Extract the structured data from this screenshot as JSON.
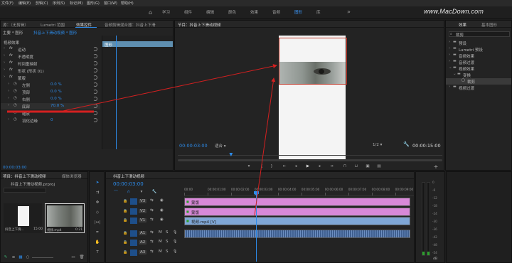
{
  "menubar": {
    "items": [
      "文件(F)",
      "编辑(E)",
      "剪辑(C)",
      "序列(S)",
      "标记(M)",
      "图形(G)",
      "窗口(W)",
      "帮助(H)"
    ]
  },
  "workspaces": {
    "items": [
      "学习",
      "组件",
      "编辑",
      "颜色",
      "效果",
      "音频",
      "图形",
      "库"
    ],
    "active_index": 6,
    "more": "»"
  },
  "watermark": {
    "text": "www.MacDown.com"
  },
  "source_panel": {
    "tabs": [
      "源：（无剪辑）",
      "Lumetri 范围",
      "效果控件",
      "音频剪辑混合器：抖音上下滑"
    ],
    "active_index": 2,
    "header_left": "主要 * 图形",
    "header_right": "抖音上下滑动视频 * 图形",
    "ruler_start": "00:00",
    "clip_bar": "图形",
    "section": "视频效果",
    "rows": [
      {
        "label": "运动",
        "indent": 0,
        "fx": true
      },
      {
        "label": "不透明度",
        "indent": 0,
        "fx": true
      },
      {
        "label": "时间重映射",
        "indent": 0,
        "fx": true
      },
      {
        "label": "形状 (形状 01)",
        "indent": 0,
        "fx": true
      },
      {
        "label": "蒙版",
        "indent": 0,
        "fx": true
      },
      {
        "label": "左侧",
        "value": "0.0 %",
        "indent": 1
      },
      {
        "label": "顶部",
        "value": "0.0 %",
        "indent": 1
      },
      {
        "label": "右侧",
        "value": "0.0 %",
        "indent": 1
      },
      {
        "label": "底部",
        "value": "70.0 %",
        "indent": 1,
        "selected": true
      },
      {
        "label": "缩放",
        "indent": 1
      },
      {
        "label": "羽化边缘",
        "value": "0",
        "indent": 1
      }
    ],
    "timecode": "00:00:03:00"
  },
  "program_panel": {
    "title": "节目：抖音上下滑动视频",
    "current_time": "00:00:03:00",
    "fit": "适合",
    "quality": "1/2",
    "duration": "00:00:15:00",
    "playhead_fraction": 0.2
  },
  "effects_panel": {
    "tabs": [
      "效果",
      "基本图形"
    ],
    "search_value": "裁剪",
    "items": [
      {
        "label": "预设",
        "indent": 0,
        "folder": true
      },
      {
        "label": "Lumetri 预设",
        "indent": 0,
        "folder": true
      },
      {
        "label": "音频效果",
        "indent": 0,
        "folder": true
      },
      {
        "label": "音频过渡",
        "indent": 0,
        "folder": true
      },
      {
        "label": "视频效果",
        "indent": 0,
        "folder": true,
        "open": true
      },
      {
        "label": "变换",
        "indent": 1,
        "folder": true,
        "open": true
      },
      {
        "label": "裁剪",
        "indent": 2,
        "folder": false,
        "selected": true
      },
      {
        "label": "视频过渡",
        "indent": 0,
        "folder": true
      }
    ]
  },
  "project_panel": {
    "tabs": [
      "项目：抖音上下滑动视频",
      "媒体浏览器",
      "库",
      "信息"
    ],
    "file": "抖音上下滑动视频.prproj",
    "item_count": "",
    "thumbs": [
      {
        "name": "抖音上下滑...",
        "duration": "15:00"
      },
      {
        "name": "视频.mp4",
        "duration": "0:21"
      }
    ]
  },
  "timeline_panel": {
    "tab": "抖音上下滑动视频",
    "timecode": "00:00:03:00",
    "ruler": [
      "00:00",
      "00:00:01:00",
      "00:00:02:00",
      "00:00:03:00",
      "00:00:04:00",
      "00:00:05:00",
      "00:00:06:00",
      "00:00:07:00",
      "00:00:08:00",
      "00:00:09:00"
    ],
    "video_tracks": [
      "V3",
      "V2",
      "V1"
    ],
    "audio_tracks": [
      "A1",
      "A2",
      "A3"
    ],
    "clips": [
      {
        "name": "蒙版",
        "track": "V3",
        "color": "#d889d8"
      },
      {
        "name": "蒙版",
        "track": "V2",
        "color": "#d889d8"
      },
      {
        "name": "视频.mp4 [V]",
        "track": "V1",
        "color": "#7fa7d6"
      }
    ]
  },
  "meter": {
    "labels": [
      "0",
      "-6",
      "-12",
      "-18",
      "-24",
      "-30",
      "-36",
      "-42",
      "-48",
      "-54"
    ],
    "unit": "dB"
  },
  "colors": {
    "accent": "#2d8ceb",
    "clip_pink": "#d889d8",
    "clip_blue": "#7fa7d6",
    "audio_clip": "#3f5f8f",
    "arrow": "#d42020"
  }
}
